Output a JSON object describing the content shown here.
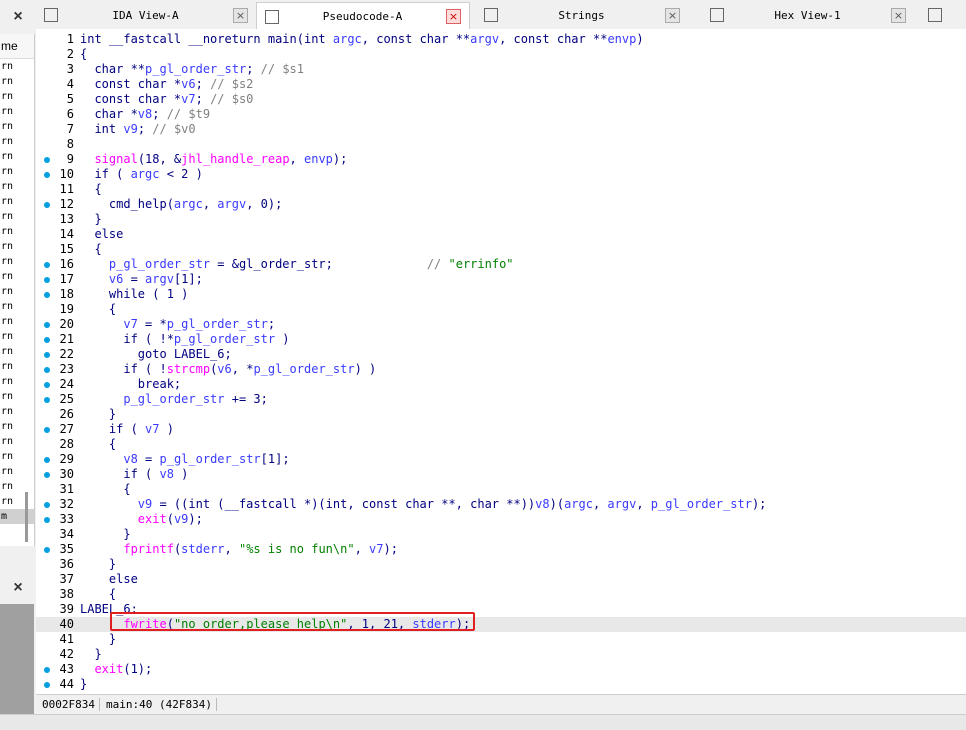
{
  "left_panel": {
    "close_top": "×",
    "header": "me",
    "rows": [
      "rn",
      "rn",
      "rn",
      "rn",
      "rn",
      "rn",
      "rn",
      "rn",
      "rn",
      "rn",
      "rn",
      "rn",
      "rn",
      "rn",
      "rn",
      "rn",
      "rn",
      "rn",
      "rn",
      "rn",
      "rn",
      "rn",
      "rn",
      "rn",
      "rn",
      "rn",
      "rn",
      "rn",
      "rn",
      "rn",
      "m"
    ],
    "close_bottom": "×"
  },
  "tabs": [
    {
      "label": "IDA View-A",
      "icon": "ida-view-icon",
      "close": "×",
      "active": false
    },
    {
      "label": "Pseudocode-A",
      "icon": "pseudocode-icon",
      "close": "×",
      "active": true
    },
    {
      "label": "Strings",
      "icon": "strings-icon",
      "close": "×",
      "active": false
    },
    {
      "label": "Hex View-1",
      "icon": "hex-view-icon",
      "close": "×",
      "active": false
    },
    {
      "label": "",
      "icon": "info-icon",
      "close": "",
      "active": false
    }
  ],
  "code": {
    "current_line": 40,
    "dotted_lines": [
      9,
      10,
      12,
      16,
      17,
      18,
      20,
      21,
      22,
      23,
      24,
      25,
      27,
      29,
      30,
      32,
      33,
      35,
      40,
      43,
      44
    ],
    "lines": [
      "int __fastcall __noreturn main(int argc, const char **argv, const char **envp)",
      "{",
      "  char **p_gl_order_str; // $s1",
      "  const char *v6; // $s2",
      "  const char *v7; // $s0",
      "  char *v8; // $t9",
      "  int v9; // $v0",
      "",
      "  signal(18, &jhl_handle_reap, envp);",
      "  if ( argc < 2 )",
      "  {",
      "    cmd_help(argc, argv, 0);",
      "  }",
      "  else",
      "  {",
      "    p_gl_order_str = &gl_order_str;             // \"errinfo\"",
      "    v6 = argv[1];",
      "    while ( 1 )",
      "    {",
      "      v7 = *p_gl_order_str;",
      "      if ( !*p_gl_order_str )",
      "        goto LABEL_6;",
      "      if ( !strcmp(v6, *p_gl_order_str) )",
      "        break;",
      "      p_gl_order_str += 3;",
      "    }",
      "    if ( v7 )",
      "    {",
      "      v8 = p_gl_order_str[1];",
      "      if ( v8 )",
      "      {",
      "        v9 = ((int (__fastcall *)(int, const char **, char **))v8)(argc, argv, p_gl_order_str);",
      "        exit(v9);",
      "      }",
      "      fprintf(stderr, \"%s is no fun\\n\", v7);",
      "    }",
      "    else",
      "    {",
      "LABEL_6:",
      "      fwrite(\"no order,please help\\n\", 1, 21, stderr);",
      "    }",
      "  }",
      "  exit(1);",
      "}"
    ]
  },
  "status": {
    "address": "0002F834",
    "location": "main:40 (42F834)"
  }
}
